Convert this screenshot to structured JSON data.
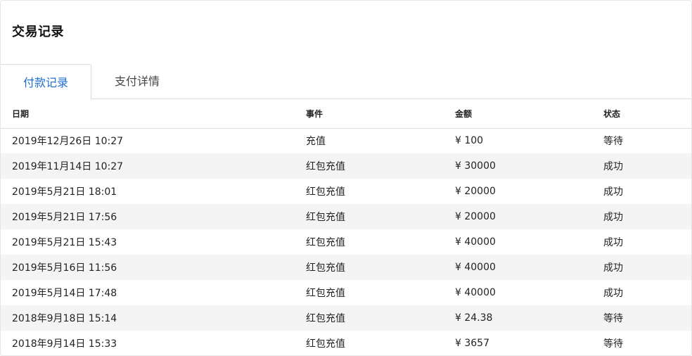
{
  "page": {
    "title": "交易记录"
  },
  "tabs": [
    {
      "label": "付款记录",
      "active": true
    },
    {
      "label": "支付详情",
      "active": false
    }
  ],
  "table": {
    "headers": [
      "日期",
      "事件",
      "金额",
      "状态"
    ],
    "rows": [
      [
        "2019年12月26日 10:27",
        "充值",
        "¥ 100",
        "等待"
      ],
      [
        "2019年11月14日 10:27",
        "红包充值",
        "¥ 30000",
        "成功"
      ],
      [
        "2019年5月21日 18:01",
        "红包充值",
        "¥ 20000",
        "成功"
      ],
      [
        "2019年5月21日 17:56",
        "红包充值",
        "¥ 20000",
        "成功"
      ],
      [
        "2019年5月21日 15:43",
        "红包充值",
        "¥ 40000",
        "成功"
      ],
      [
        "2019年5月16日 11:56",
        "红包充值",
        "¥ 40000",
        "成功"
      ],
      [
        "2019年5月14日 17:48",
        "红包充值",
        "¥ 40000",
        "成功"
      ],
      [
        "2018年9月18日 15:14",
        "红包充值",
        "¥ 24.38",
        "等待"
      ],
      [
        "2018年9月14日 15:33",
        "红包充值",
        "¥ 3657",
        "等待"
      ]
    ]
  },
  "colors": {
    "accent": "#1f6fd1",
    "row_alt": "#f4f4f4",
    "border": "#dcdcdc"
  }
}
